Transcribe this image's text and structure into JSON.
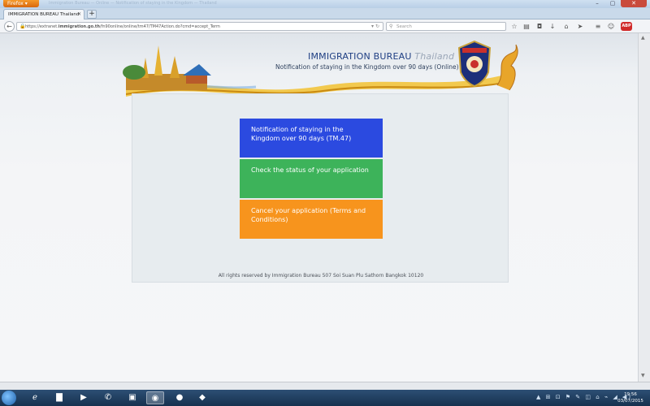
{
  "browser": {
    "menu_label": "Firefox ▾",
    "background_tabs": "Immigration Bureau — Online — Notification of staying in the Kingdom — Thailand",
    "tab_title": "IMMIGRATION BUREAU Thailand",
    "url_domain_pre": "https://extranet.",
    "url_domain": "immigration.go.th",
    "url_path": "/fn90online/online/tm47/TM47Action.do?cmd=accept_Term",
    "search_placeholder": "Search",
    "abp_label": "ABP"
  },
  "page": {
    "title_main": "IMMIGRATION BUREAU",
    "title_accent": "Thailand",
    "subtitle": "Notification of staying in the Kingdom over 90 days (Online)",
    "buttons": {
      "notify": "Notification of staying in the Kingdom over 90 days (TM.47)",
      "status": "Check the status of your application",
      "cancel": "Cancel your application (Terms and Conditions)"
    },
    "footer": "All rights reserved by Immigration Bureau 507 Soi Suan Plu Sathorn Bangkok 10120"
  },
  "taskbar": {
    "time": "19:56",
    "date": "03/07/2015"
  },
  "colors": {
    "blue_button": "#2b4ae0",
    "green_button": "#3db35a",
    "orange_button": "#f7941d",
    "title_color": "#1f3f83"
  }
}
